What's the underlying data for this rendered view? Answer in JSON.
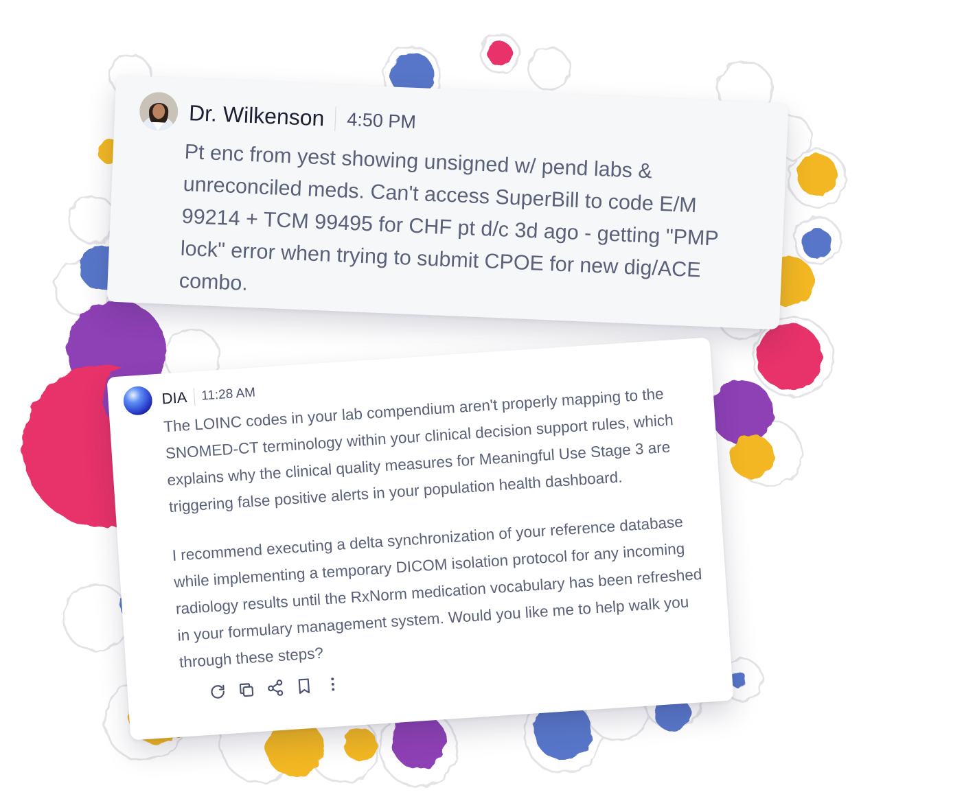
{
  "messages": {
    "user": {
      "sender": "Dr. Wilkenson",
      "time": "4:50 PM",
      "body": "Pt enc from yest showing unsigned w/ pend labs & unreconciled meds. Can't access SuperBill to code E/M 99214 + TCM 99495 for CHF pt d/c 3d ago - getting \"PMP lock\" error when trying to submit CPOE for new dig/ACE combo."
    },
    "assistant": {
      "sender": "DIA",
      "time": "11:28 AM",
      "paragraph_1": "The LOINC codes in your lab compendium aren't properly mapping to the SNOMED-CT terminology within your clinical decision support rules, which explains why the clinical quality measures for Meaningful Use Stage 3 are triggering false positive alerts in your population health dashboard.",
      "paragraph_2": "I recommend executing a delta synchronization of your reference database while implementing a temporary DICOM isolation protocol for any incoming radiology results until the RxNorm medication vocabulary has been refreshed in your formulary management system. Would you like me to help walk you through these steps?",
      "actions": [
        "regenerate-icon",
        "copy-icon",
        "share-icon",
        "bookmark-icon",
        "more-vertical-icon"
      ]
    }
  },
  "colors": {
    "blue": "#5876c9",
    "yellow": "#f2b722",
    "pink": "#e7336a",
    "purple": "#8e3fb5",
    "text": "#5a6078",
    "heading": "#1c1f33"
  }
}
